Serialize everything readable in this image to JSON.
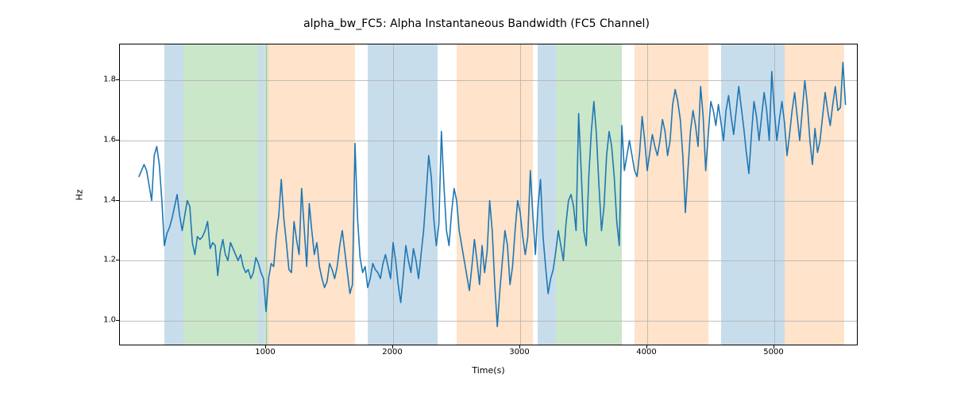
{
  "chart_data": {
    "type": "line",
    "title": "alpha_bw_FC5: Alpha Instantaneous Bandwidth (FC5 Channel)",
    "xlabel": "Time(s)",
    "ylabel": "Hz",
    "xlim": [
      -150,
      5650
    ],
    "ylim": [
      0.92,
      1.92
    ],
    "xticks": [
      1000,
      2000,
      3000,
      4000,
      5000
    ],
    "yticks": [
      1.0,
      1.2,
      1.4,
      1.6,
      1.8
    ],
    "shaded_regions": [
      {
        "x0": 200,
        "x1": 350,
        "color": "blue"
      },
      {
        "x0": 350,
        "x1": 940,
        "color": "green"
      },
      {
        "x0": 940,
        "x1": 980,
        "color": "blue"
      },
      {
        "x0": 980,
        "x1": 1020,
        "color": "green"
      },
      {
        "x0": 1020,
        "x1": 1700,
        "color": "orange"
      },
      {
        "x0": 1800,
        "x1": 2350,
        "color": "blue"
      },
      {
        "x0": 2500,
        "x1": 3100,
        "color": "orange"
      },
      {
        "x0": 3140,
        "x1": 3280,
        "color": "blue"
      },
      {
        "x0": 3280,
        "x1": 3800,
        "color": "green"
      },
      {
        "x0": 3900,
        "x1": 4480,
        "color": "orange"
      },
      {
        "x0": 4580,
        "x1": 5080,
        "color": "blue"
      },
      {
        "x0": 5080,
        "x1": 5550,
        "color": "orange"
      }
    ],
    "series": [
      {
        "name": "alpha_bw_FC5",
        "x_start": 0,
        "x_step": 20,
        "values": [
          1.48,
          1.5,
          1.52,
          1.5,
          1.45,
          1.4,
          1.55,
          1.58,
          1.52,
          1.4,
          1.25,
          1.29,
          1.31,
          1.34,
          1.38,
          1.42,
          1.35,
          1.3,
          1.35,
          1.4,
          1.38,
          1.26,
          1.22,
          1.28,
          1.27,
          1.28,
          1.3,
          1.33,
          1.24,
          1.26,
          1.25,
          1.15,
          1.23,
          1.27,
          1.22,
          1.2,
          1.26,
          1.24,
          1.22,
          1.2,
          1.22,
          1.18,
          1.16,
          1.17,
          1.14,
          1.16,
          1.21,
          1.19,
          1.16,
          1.14,
          1.03,
          1.14,
          1.19,
          1.18,
          1.28,
          1.35,
          1.47,
          1.34,
          1.26,
          1.17,
          1.16,
          1.33,
          1.27,
          1.22,
          1.44,
          1.31,
          1.18,
          1.39,
          1.3,
          1.22,
          1.26,
          1.18,
          1.14,
          1.11,
          1.13,
          1.19,
          1.17,
          1.14,
          1.18,
          1.25,
          1.3,
          1.23,
          1.16,
          1.09,
          1.12,
          1.59,
          1.34,
          1.21,
          1.16,
          1.18,
          1.11,
          1.14,
          1.19,
          1.17,
          1.16,
          1.14,
          1.19,
          1.22,
          1.18,
          1.14,
          1.26,
          1.2,
          1.12,
          1.06,
          1.15,
          1.25,
          1.2,
          1.16,
          1.24,
          1.2,
          1.14,
          1.22,
          1.3,
          1.42,
          1.55,
          1.48,
          1.34,
          1.25,
          1.32,
          1.63,
          1.45,
          1.3,
          1.25,
          1.36,
          1.44,
          1.4,
          1.3,
          1.25,
          1.2,
          1.15,
          1.1,
          1.18,
          1.27,
          1.2,
          1.12,
          1.25,
          1.16,
          1.23,
          1.4,
          1.3,
          1.12,
          0.98,
          1.1,
          1.2,
          1.3,
          1.25,
          1.12,
          1.18,
          1.3,
          1.4,
          1.36,
          1.28,
          1.22,
          1.28,
          1.5,
          1.35,
          1.22,
          1.38,
          1.47,
          1.28,
          1.18,
          1.09,
          1.14,
          1.17,
          1.23,
          1.3,
          1.25,
          1.2,
          1.32,
          1.4,
          1.42,
          1.38,
          1.3,
          1.69,
          1.5,
          1.3,
          1.25,
          1.48,
          1.63,
          1.73,
          1.62,
          1.45,
          1.3,
          1.38,
          1.55,
          1.63,
          1.58,
          1.48,
          1.33,
          1.25,
          1.65,
          1.5,
          1.55,
          1.6,
          1.55,
          1.5,
          1.48,
          1.56,
          1.68,
          1.6,
          1.5,
          1.56,
          1.62,
          1.58,
          1.55,
          1.6,
          1.67,
          1.63,
          1.55,
          1.6,
          1.72,
          1.77,
          1.73,
          1.67,
          1.55,
          1.36,
          1.5,
          1.63,
          1.7,
          1.65,
          1.58,
          1.78,
          1.68,
          1.5,
          1.62,
          1.73,
          1.7,
          1.65,
          1.72,
          1.66,
          1.6,
          1.7,
          1.75,
          1.68,
          1.62,
          1.7,
          1.78,
          1.71,
          1.64,
          1.56,
          1.49,
          1.62,
          1.73,
          1.68,
          1.6,
          1.68,
          1.76,
          1.7,
          1.6,
          1.83,
          1.7,
          1.6,
          1.67,
          1.73,
          1.66,
          1.55,
          1.62,
          1.7,
          1.76,
          1.68,
          1.6,
          1.7,
          1.8,
          1.72,
          1.6,
          1.52,
          1.64,
          1.56,
          1.6,
          1.68,
          1.76,
          1.7,
          1.65,
          1.72,
          1.78,
          1.7,
          1.71,
          1.86,
          1.72
        ]
      }
    ]
  }
}
